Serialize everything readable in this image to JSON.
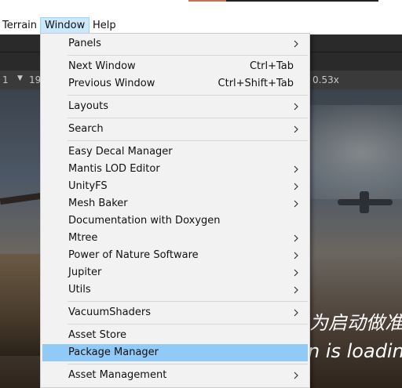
{
  "menubar": {
    "items": [
      {
        "label": "Terrain",
        "active": false
      },
      {
        "label": "Window",
        "active": true
      },
      {
        "label": "Help",
        "active": false
      }
    ]
  },
  "toolbar": {
    "left_value": "1",
    "second_value": "19",
    "zoom": "0.53x"
  },
  "scene": {
    "overlay_cn": "为启动做准",
    "overlay_en": "n is loading"
  },
  "window_menu": {
    "items": [
      {
        "label": "Panels",
        "submenu": true
      },
      {
        "label": "Next Window",
        "shortcut": "Ctrl+Tab"
      },
      {
        "label": "Previous Window",
        "shortcut": "Ctrl+Shift+Tab"
      },
      {
        "label": "Layouts",
        "submenu": true
      },
      {
        "label": "Search",
        "submenu": true
      },
      {
        "label": "Easy Decal Manager"
      },
      {
        "label": "Mantis LOD Editor",
        "submenu": true
      },
      {
        "label": "UnityFS",
        "submenu": true
      },
      {
        "label": "Mesh Baker",
        "submenu": true
      },
      {
        "label": "Documentation with Doxygen"
      },
      {
        "label": "Mtree",
        "submenu": true
      },
      {
        "label": "Power of Nature Software",
        "submenu": true
      },
      {
        "label": "Jupiter",
        "submenu": true
      },
      {
        "label": "Utils",
        "submenu": true
      },
      {
        "label": "VacuumShaders",
        "submenu": true
      },
      {
        "label": "Asset Store"
      },
      {
        "label": "Package Manager",
        "highlighted": true
      },
      {
        "label": "Asset Management",
        "submenu": true
      }
    ]
  },
  "colors": {
    "menu_bg": "#f2f2f2",
    "highlight": "#91c9f7",
    "menubar_active": "#cce8ff"
  }
}
